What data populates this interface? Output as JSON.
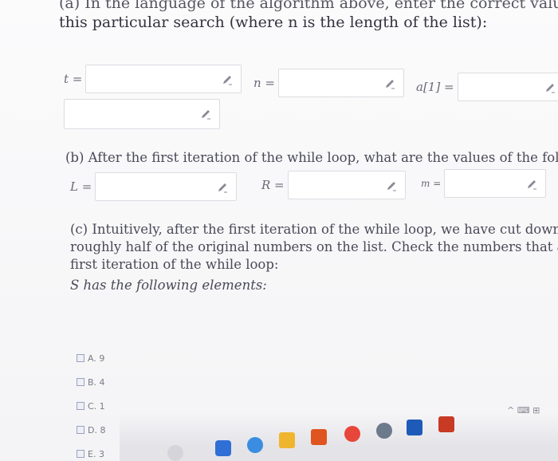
{
  "question": {
    "header_line1": "(a) In the language of the algorithm above, enter the correct values for the following variables for",
    "header_line2": "this particular search (where n is the length of the list):"
  },
  "part_a": {
    "fields": [
      {
        "label": "t =",
        "value": ""
      },
      {
        "label": "n =",
        "value": ""
      },
      {
        "label": "a[1] =",
        "value": ""
      },
      {
        "label": "",
        "value": ""
      }
    ]
  },
  "part_b": {
    "prompt": "(b) After the first iteration of the while loop, what are the values of the following variables?",
    "fields": [
      {
        "label": "L =",
        "value": ""
      },
      {
        "label": "R =",
        "value": ""
      },
      {
        "label": "m =",
        "value": ""
      }
    ]
  },
  "part_c": {
    "line1": "(c) Intuitively, after the first iteration of the while loop, we have cut down our search to a set S of",
    "line2": "roughly half of the original numbers on the list. Check the numbers that are in the set S after the",
    "line3": "first iteration of the while loop:",
    "line4": "S has the following elements:",
    "options": [
      {
        "label": "A. 9",
        "checked": false
      },
      {
        "label": "B. 4",
        "checked": false
      },
      {
        "label": "C. 1",
        "checked": false
      },
      {
        "label": "D. 8",
        "checked": false
      },
      {
        "label": "E. 3",
        "checked": false
      }
    ]
  },
  "taskbar": {
    "icons": [
      "search-icon",
      "chrome-icon",
      "edge-icon",
      "file-explorer-icon",
      "office-icon",
      "chrome-profile-icon",
      "word-icon",
      "powerpoint-icon"
    ],
    "tray_text": "^ ⌨ ⊞"
  },
  "colors": {
    "text": "#2e2e3a",
    "input_border": "#dcdce2",
    "checkbox_border": "#9aa3c0"
  }
}
